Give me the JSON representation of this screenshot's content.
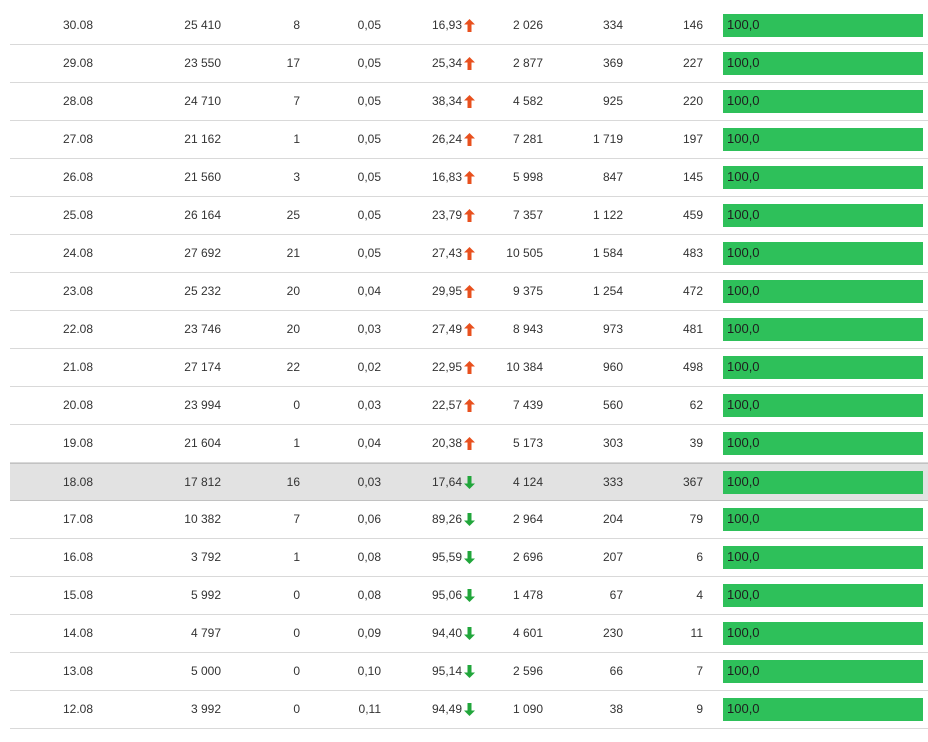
{
  "colors": {
    "up_arrow": "#e8501e",
    "down_arrow": "#21a63b",
    "bar": "#2ec05a",
    "highlight_row": "#e2e2e2"
  },
  "rows": [
    {
      "date": "30.08",
      "a": "25 410",
      "b": "8",
      "c": "0,05",
      "d": "16,93",
      "trend": "up",
      "e": "2 026",
      "f": "334",
      "g": "146",
      "bar": "100,0",
      "bar_fraction": 1.0,
      "highlight": false
    },
    {
      "date": "29.08",
      "a": "23 550",
      "b": "17",
      "c": "0,05",
      "d": "25,34",
      "trend": "up",
      "e": "2 877",
      "f": "369",
      "g": "227",
      "bar": "100,0",
      "bar_fraction": 1.0,
      "highlight": false
    },
    {
      "date": "28.08",
      "a": "24 710",
      "b": "7",
      "c": "0,05",
      "d": "38,34",
      "trend": "up",
      "e": "4 582",
      "f": "925",
      "g": "220",
      "bar": "100,0",
      "bar_fraction": 1.0,
      "highlight": false
    },
    {
      "date": "27.08",
      "a": "21 162",
      "b": "1",
      "c": "0,05",
      "d": "26,24",
      "trend": "up",
      "e": "7 281",
      "f": "1 719",
      "g": "197",
      "bar": "100,0",
      "bar_fraction": 1.0,
      "highlight": false
    },
    {
      "date": "26.08",
      "a": "21 560",
      "b": "3",
      "c": "0,05",
      "d": "16,83",
      "trend": "up",
      "e": "5 998",
      "f": "847",
      "g": "145",
      "bar": "100,0",
      "bar_fraction": 1.0,
      "highlight": false
    },
    {
      "date": "25.08",
      "a": "26 164",
      "b": "25",
      "c": "0,05",
      "d": "23,79",
      "trend": "up",
      "e": "7 357",
      "f": "1 122",
      "g": "459",
      "bar": "100,0",
      "bar_fraction": 1.0,
      "highlight": false
    },
    {
      "date": "24.08",
      "a": "27 692",
      "b": "21",
      "c": "0,05",
      "d": "27,43",
      "trend": "up",
      "e": "10 505",
      "f": "1 584",
      "g": "483",
      "bar": "100,0",
      "bar_fraction": 1.0,
      "highlight": false
    },
    {
      "date": "23.08",
      "a": "25 232",
      "b": "20",
      "c": "0,04",
      "d": "29,95",
      "trend": "up",
      "e": "9 375",
      "f": "1 254",
      "g": "472",
      "bar": "100,0",
      "bar_fraction": 1.0,
      "highlight": false
    },
    {
      "date": "22.08",
      "a": "23 746",
      "b": "20",
      "c": "0,03",
      "d": "27,49",
      "trend": "up",
      "e": "8 943",
      "f": "973",
      "g": "481",
      "bar": "100,0",
      "bar_fraction": 1.0,
      "highlight": false
    },
    {
      "date": "21.08",
      "a": "27 174",
      "b": "22",
      "c": "0,02",
      "d": "22,95",
      "trend": "up",
      "e": "10 384",
      "f": "960",
      "g": "498",
      "bar": "100,0",
      "bar_fraction": 1.0,
      "highlight": false
    },
    {
      "date": "20.08",
      "a": "23 994",
      "b": "0",
      "c": "0,03",
      "d": "22,57",
      "trend": "up",
      "e": "7 439",
      "f": "560",
      "g": "62",
      "bar": "100,0",
      "bar_fraction": 1.0,
      "highlight": false
    },
    {
      "date": "19.08",
      "a": "21 604",
      "b": "1",
      "c": "0,04",
      "d": "20,38",
      "trend": "up",
      "e": "5 173",
      "f": "303",
      "g": "39",
      "bar": "100,0",
      "bar_fraction": 1.0,
      "highlight": false
    },
    {
      "date": "18.08",
      "a": "17 812",
      "b": "16",
      "c": "0,03",
      "d": "17,64",
      "trend": "down",
      "e": "4 124",
      "f": "333",
      "g": "367",
      "bar": "100,0",
      "bar_fraction": 1.0,
      "highlight": true
    },
    {
      "date": "17.08",
      "a": "10 382",
      "b": "7",
      "c": "0,06",
      "d": "89,26",
      "trend": "down",
      "e": "2 964",
      "f": "204",
      "g": "79",
      "bar": "100,0",
      "bar_fraction": 1.0,
      "highlight": false
    },
    {
      "date": "16.08",
      "a": "3 792",
      "b": "1",
      "c": "0,08",
      "d": "95,59",
      "trend": "down",
      "e": "2 696",
      "f": "207",
      "g": "6",
      "bar": "100,0",
      "bar_fraction": 1.0,
      "highlight": false
    },
    {
      "date": "15.08",
      "a": "5 992",
      "b": "0",
      "c": "0,08",
      "d": "95,06",
      "trend": "down",
      "e": "1 478",
      "f": "67",
      "g": "4",
      "bar": "100,0",
      "bar_fraction": 1.0,
      "highlight": false
    },
    {
      "date": "14.08",
      "a": "4 797",
      "b": "0",
      "c": "0,09",
      "d": "94,40",
      "trend": "down",
      "e": "4 601",
      "f": "230",
      "g": "11",
      "bar": "100,0",
      "bar_fraction": 1.0,
      "highlight": false
    },
    {
      "date": "13.08",
      "a": "5 000",
      "b": "0",
      "c": "0,10",
      "d": "95,14",
      "trend": "down",
      "e": "2 596",
      "f": "66",
      "g": "7",
      "bar": "100,0",
      "bar_fraction": 1.0,
      "highlight": false
    },
    {
      "date": "12.08",
      "a": "3 992",
      "b": "0",
      "c": "0,11",
      "d": "94,49",
      "trend": "down",
      "e": "1 090",
      "f": "38",
      "g": "9",
      "bar": "100,0",
      "bar_fraction": 1.0,
      "highlight": false
    }
  ]
}
